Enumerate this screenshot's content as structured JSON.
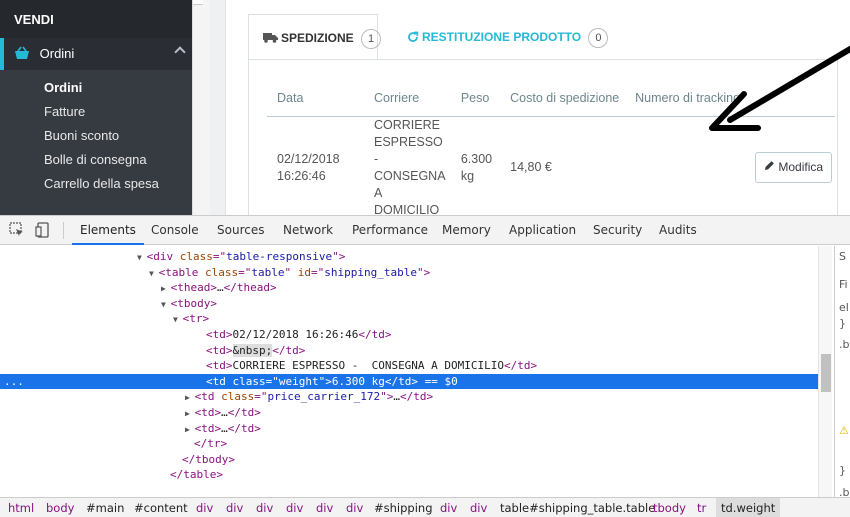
{
  "sidebar": {
    "section_title": "VENDI",
    "menu_label": "Ordini",
    "sub_items": [
      "Ordini",
      "Fatture",
      "Buoni sconto",
      "Bolle di consegna",
      "Carrello della spesa"
    ]
  },
  "tabs": [
    {
      "label": "SPEDIZIONE",
      "count": "1",
      "icon": "truck-icon"
    },
    {
      "label": "RESTITUZIONE PRODOTTO",
      "count": "0",
      "icon": "refresh-icon"
    }
  ],
  "shipping_table": {
    "headers": [
      "Data",
      "Corriere",
      "Peso",
      "Costo di spedizione",
      "Numero di tracking"
    ],
    "row": {
      "date": "02/12/2018 16:26:46",
      "carrier": "CORRIERE ESPRESSO - CONSEGNA A DOMICILIO",
      "weight": "6.300 kg",
      "cost": "14,80 €",
      "tracking": "",
      "edit_label": "Modifica"
    }
  },
  "devtools": {
    "tabs": [
      "Elements",
      "Console",
      "Sources",
      "Network",
      "Performance",
      "Memory",
      "Application",
      "Security",
      "Audits"
    ],
    "active_tab": "Elements",
    "dom_lines": [
      {
        "tri": "▼",
        "parts": [
          [
            "tg",
            "<div "
          ],
          [
            "at",
            "class"
          ],
          [
            "tg",
            "=\""
          ],
          [
            "av",
            "table-responsive"
          ],
          [
            "tg",
            "\">"
          ]
        ]
      },
      {
        "tri": "▼",
        "parts": [
          [
            "tg",
            "<table "
          ],
          [
            "at",
            "class"
          ],
          [
            "tg",
            "=\""
          ],
          [
            "av",
            "table"
          ],
          [
            "tg",
            "\" "
          ],
          [
            "at",
            "id"
          ],
          [
            "tg",
            "=\""
          ],
          [
            "av",
            "shipping_table"
          ],
          [
            "tg",
            "\">"
          ]
        ]
      },
      {
        "tri": "▶",
        "parts": [
          [
            "tg",
            "<thead>"
          ],
          [
            "tx",
            "…"
          ],
          [
            "tg",
            "</thead>"
          ]
        ]
      },
      {
        "tri": "▼",
        "parts": [
          [
            "tg",
            "<tbody>"
          ]
        ]
      },
      {
        "tri": "▼",
        "parts": [
          [
            "tg",
            "<tr>"
          ]
        ]
      },
      {
        "tri": "",
        "parts": [
          [
            "tg",
            "<td>"
          ],
          [
            "tx",
            "02/12/2018 16:26:46"
          ],
          [
            "tg",
            "</td>"
          ]
        ]
      },
      {
        "tri": "",
        "parts": [
          [
            "tg",
            "<td>"
          ],
          [
            "ent",
            "&nbsp;"
          ],
          [
            "tg",
            "</td>"
          ]
        ]
      },
      {
        "tri": "",
        "parts": [
          [
            "tg",
            "<td>"
          ],
          [
            "tx",
            "CORRIERE ESPRESSO -  CONSEGNA A DOMICILIO"
          ],
          [
            "tg",
            "</td>"
          ]
        ]
      },
      {
        "tri": "",
        "parts": [
          [
            "tg",
            "<td "
          ],
          [
            "at",
            "class"
          ],
          [
            "tg",
            "=\""
          ],
          [
            "av",
            "weight"
          ],
          [
            "tg",
            "\">"
          ],
          [
            "tx",
            "6.300 kg"
          ],
          [
            "tg",
            "</td>"
          ],
          [
            "gray",
            " == $0"
          ]
        ],
        "selected": true
      },
      {
        "tri": "▶",
        "parts": [
          [
            "tg",
            "<td "
          ],
          [
            "at",
            "class"
          ],
          [
            "tg",
            "=\""
          ],
          [
            "av",
            "price_carrier_172"
          ],
          [
            "tg",
            "\">"
          ],
          [
            "tx",
            "…"
          ],
          [
            "tg",
            "</td>"
          ]
        ]
      },
      {
        "tri": "▶",
        "parts": [
          [
            "tg",
            "<td>"
          ],
          [
            "tx",
            "…"
          ],
          [
            "tg",
            "</td>"
          ]
        ]
      },
      {
        "tri": "▶",
        "parts": [
          [
            "tg",
            "<td>"
          ],
          [
            "tx",
            "…"
          ],
          [
            "tg",
            "</td>"
          ]
        ]
      },
      {
        "tri": "",
        "parts": [
          [
            "tg",
            "</tr>"
          ]
        ]
      },
      {
        "tri": "",
        "parts": [
          [
            "tg",
            "</tbody>"
          ]
        ]
      },
      {
        "tri": "",
        "parts": [
          [
            "tg",
            "</table>"
          ]
        ]
      }
    ],
    "styles_fragments": [
      "S",
      "Fi",
      "el",
      "}",
      ".b",
      "⚠",
      "}",
      ".b",
      ".b"
    ],
    "breadcrumb": [
      "html",
      "body",
      "#main",
      "#content",
      "div",
      "div",
      "div",
      "div",
      "div",
      "div",
      "#shipping",
      "div",
      "div",
      "table#shipping_table.table",
      "tbody",
      "tr",
      "td.weight"
    ]
  }
}
